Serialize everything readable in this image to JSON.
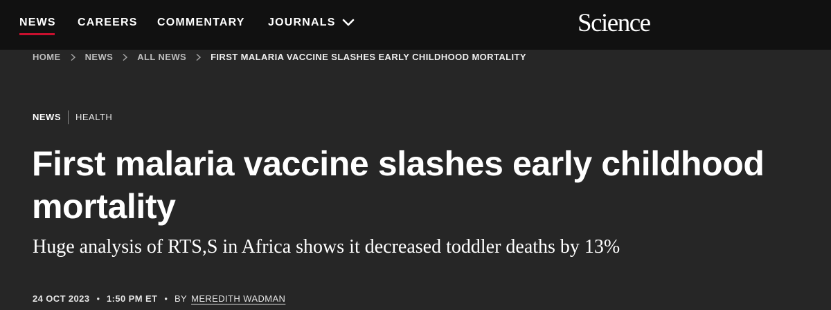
{
  "nav": {
    "items": [
      {
        "label": "NEWS",
        "active": true
      },
      {
        "label": "CAREERS"
      },
      {
        "label": "COMMENTARY"
      },
      {
        "label": "JOURNALS",
        "icon": "chevron-down-icon"
      }
    ],
    "logo": "Science",
    "active_color": "#c8102e"
  },
  "breadcrumb": [
    "HOME",
    "NEWS",
    "ALL NEWS",
    "FIRST MALARIA VACCINE SLASHES EARLY CHILDHOOD MORTALITY"
  ],
  "breadcrumb_separator_icon": "chevron-right-icon",
  "article": {
    "section": "NEWS",
    "topic": "HEALTH",
    "title": "First malaria vaccine slashes early childhood mortality",
    "subtitle": "Huge analysis of RTS,S in Africa shows it decreased toddler deaths by 13%",
    "date": "24 OCT 2023",
    "time": "1:50 PM ET",
    "separator": "•",
    "byline_prefix": "BY",
    "author": "MEREDITH WADMAN"
  }
}
